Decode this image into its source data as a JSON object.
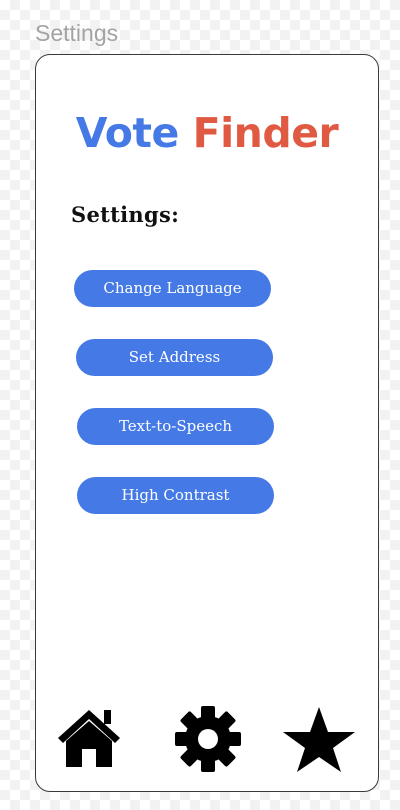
{
  "frame": {
    "label": "Settings"
  },
  "app": {
    "title_part1": "Vote",
    "title_part2": "Finder",
    "title_colors": {
      "vote": "#4479e6",
      "finder": "#e05a43"
    }
  },
  "settings": {
    "heading": "Settings:",
    "buttons": [
      {
        "label": "Change Language"
      },
      {
        "label": "Set Address"
      },
      {
        "label": "Text-to-Speech"
      },
      {
        "label": "High Contrast"
      }
    ],
    "button_color": "#4479e6"
  },
  "nav": {
    "items": [
      {
        "icon": "home-icon"
      },
      {
        "icon": "gear-icon"
      },
      {
        "icon": "star-icon"
      }
    ]
  }
}
